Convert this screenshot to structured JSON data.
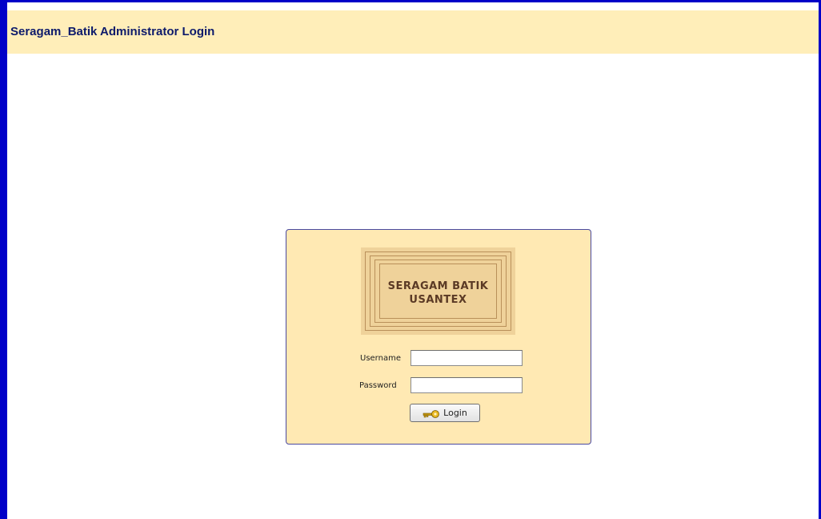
{
  "header": {
    "title": "Seragam_Batik Administrator Login"
  },
  "logo": {
    "line1": "SERAGAM BATIK",
    "line2": "USANTEX"
  },
  "form": {
    "username_label": "Username",
    "username_value": "",
    "password_label": "Password",
    "password_value": "",
    "login_button_label": "Login",
    "login_icon": "key-icon"
  },
  "colors": {
    "frame_border": "#0000c8",
    "header_bg": "#ffeeb9",
    "header_text": "#0d1a6b",
    "panel_bg": "#ffe9b3",
    "logo_bg": "#efd29a",
    "logo_text": "#5b3a25"
  }
}
